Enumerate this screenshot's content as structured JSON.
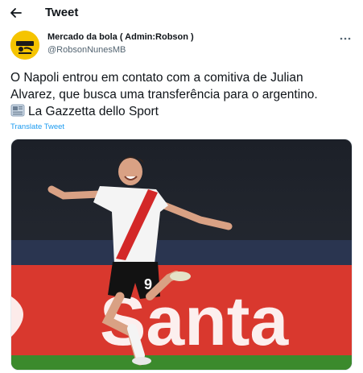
{
  "header": {
    "title": "Tweet",
    "back_icon": "arrow-left-icon"
  },
  "author": {
    "display_name": "Mercado da bola ( Admin:Robson )",
    "handle": "@RobsonNunesMB",
    "avatar_icon": "avatar-logo",
    "more_icon": "more-horizontal-icon"
  },
  "tweet": {
    "line1": "O Napoli entrou em contato com a comitiva de Julian",
    "line2": "Alvarez, que busca uma transferência para o argentino.",
    "line3": "La Gazzetta dello Sport",
    "newspaper_icon": "newspaper-emoji-icon",
    "translate_label": "Translate Tweet"
  },
  "media": {
    "jersey_number": "9",
    "background_brand": "Santa",
    "colors": {
      "stands": "#1a1d24",
      "banner": "#d9382e",
      "pitch": "#3b8a2c",
      "jersey": "#f4f4f4",
      "sash": "#d32828",
      "shorts": "#121212"
    }
  }
}
